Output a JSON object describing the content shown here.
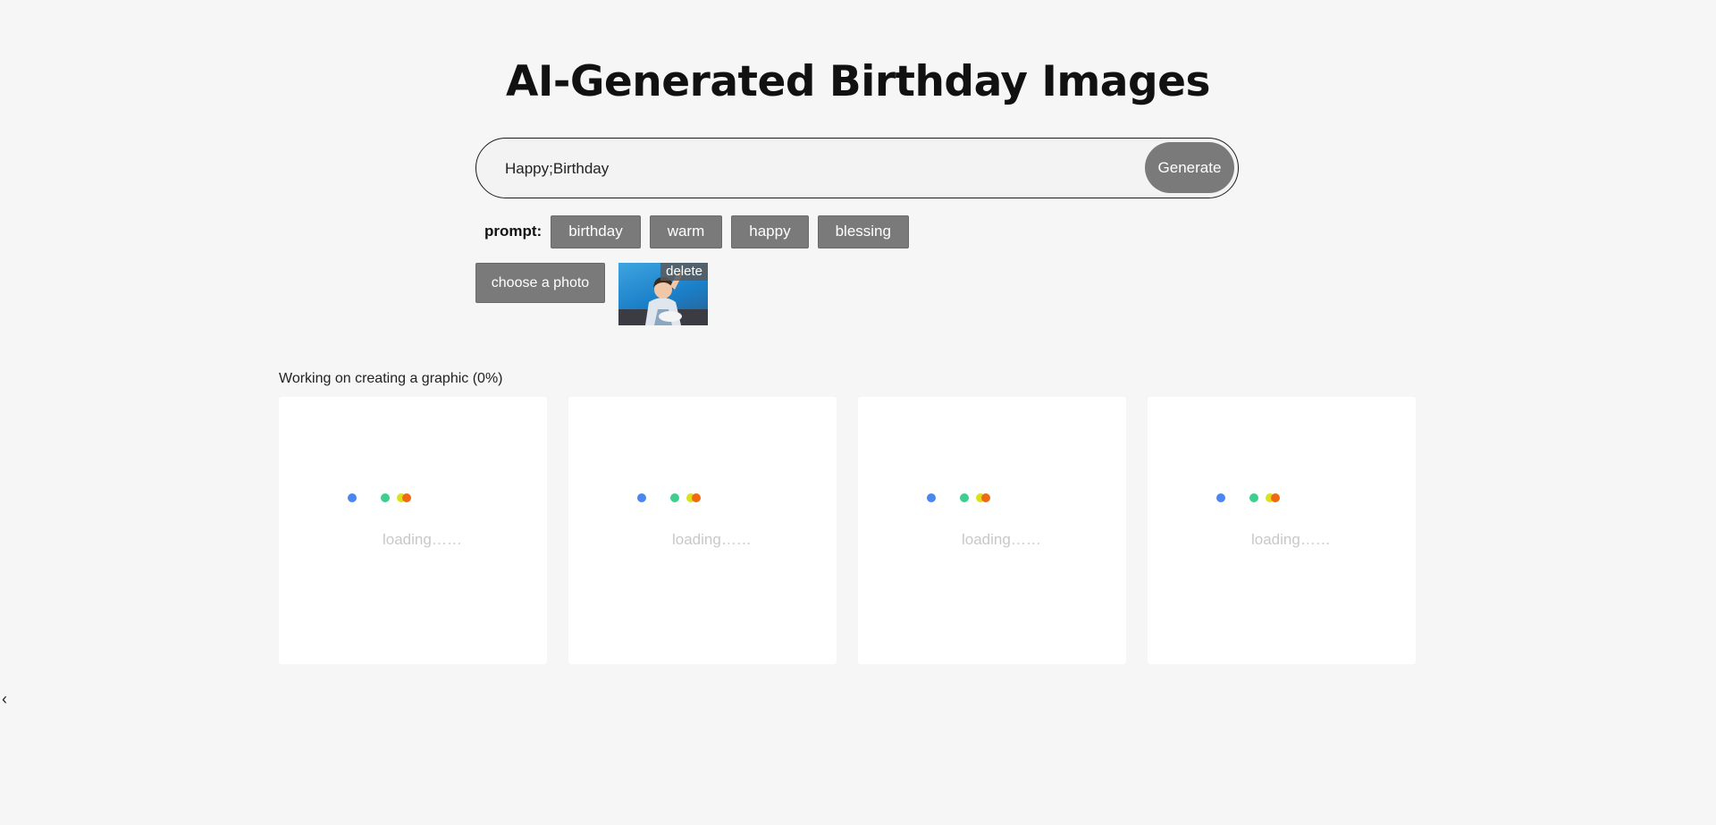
{
  "page": {
    "title": "AI-Generated Birthday Images"
  },
  "search": {
    "value": "Happy;Birthday",
    "generate_label": "Generate"
  },
  "prompts": {
    "label": "prompt:",
    "tags": [
      "birthday",
      "warm",
      "happy",
      "blessing"
    ]
  },
  "photo": {
    "choose_label": "choose a photo",
    "delete_label": "delete"
  },
  "status": {
    "text": "Working on creating a graphic (0%)"
  },
  "cards": [
    {
      "loading_text": "loading……"
    },
    {
      "loading_text": "loading……"
    },
    {
      "loading_text": "loading……"
    },
    {
      "loading_text": "loading……"
    }
  ],
  "loader_colors": [
    "#4a86f0",
    "#3ecf8e",
    "#d9e21b",
    "#f06a12"
  ],
  "nav": {
    "back_icon": "chevron-left-icon",
    "back_glyph": "‹"
  }
}
